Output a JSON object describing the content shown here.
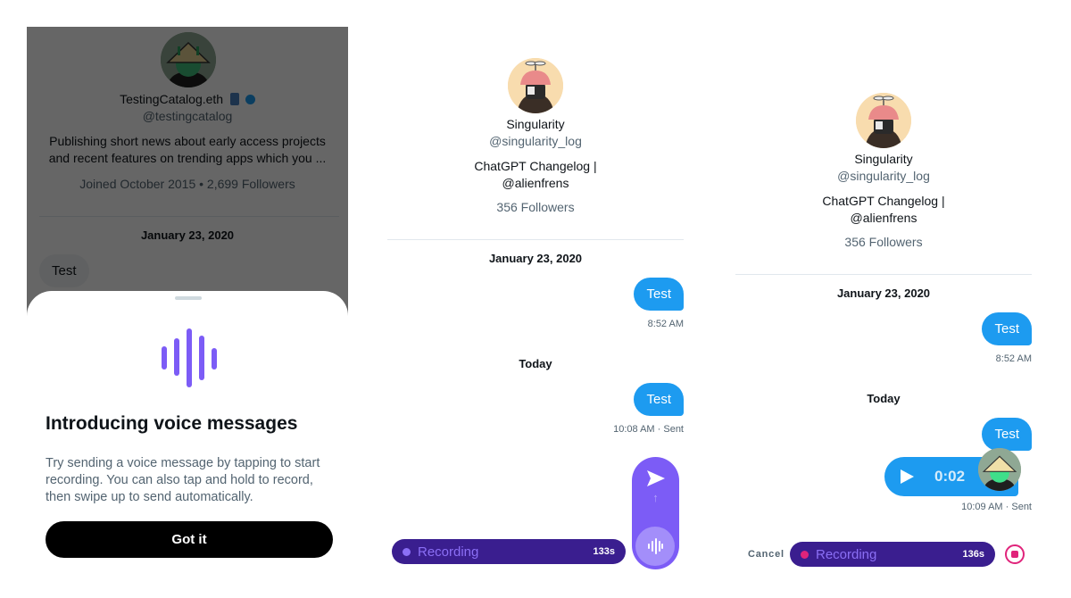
{
  "panel1": {
    "profile": {
      "name": "TestingCatalog.eth",
      "handle": "@testingcatalog",
      "bio_line1": "Publishing short news about early access projects",
      "bio_line2": "and recent features on trending apps which you ...",
      "meta": "Joined October 2015 • 2,699 Followers",
      "verified": true
    },
    "date_separator": "January 23, 2020",
    "incoming_message": "Test",
    "sheet": {
      "title": "Introducing voice messages",
      "body": "Try sending a voice message by tapping to start recording. You can also tap and hold to record, then swipe up to send automatically.",
      "button_label": "Got it",
      "icon": "waveform-icon"
    }
  },
  "panel2": {
    "profile": {
      "name": "Singularity",
      "handle": "@singularity_log",
      "bio_line1": "ChatGPT Changelog |",
      "bio_line2": "@alienfrens",
      "meta": "356 Followers"
    },
    "date_separator": "January 23, 2020",
    "messages": [
      {
        "text": "Test",
        "timestamp": "8:52 AM"
      },
      {
        "text": "Test",
        "timestamp": "10:08 AM · Sent"
      }
    ],
    "today_label": "Today",
    "recording": {
      "label": "Recording",
      "elapsed": "133s",
      "dot_color": "#8b6ff5"
    },
    "send_icon": "send-icon",
    "swipe_hint_icon": "arrow-up-icon",
    "mic_icon": "waveform-icon"
  },
  "panel3": {
    "profile": {
      "name": "Singularity",
      "handle": "@singularity_log",
      "bio_line1": "ChatGPT Changelog |",
      "bio_line2": "@alienfrens",
      "meta": "356 Followers"
    },
    "date_separator": "January 23, 2020",
    "messages": [
      {
        "text": "Test",
        "timestamp": "8:52 AM"
      },
      {
        "text": "Test"
      }
    ],
    "today_label": "Today",
    "voice_message": {
      "duration": "0:02",
      "timestamp": "10:09 AM · Sent"
    },
    "cancel_label": "Cancel",
    "recording": {
      "label": "Recording",
      "elapsed": "136s",
      "dot_color": "#e0247b"
    }
  },
  "colors": {
    "twitter_blue": "#1d9bf0",
    "voice_purple": "#7c5cf6",
    "recording_bar": "#3a1e8f",
    "stop_pink": "#e0247b"
  }
}
